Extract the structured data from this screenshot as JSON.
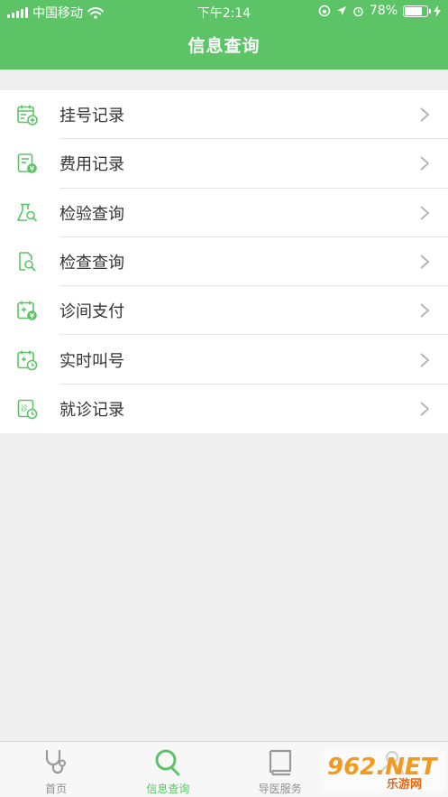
{
  "status": {
    "carrier": "中国移动",
    "time": "下午2:14",
    "battery": "78%",
    "battery_level": 0.78
  },
  "nav": {
    "title": "信息查询"
  },
  "menu": {
    "items": [
      {
        "label": "挂号记录",
        "icon": "calendar-plus-icon"
      },
      {
        "label": "费用记录",
        "icon": "bill-icon"
      },
      {
        "label": "检验查询",
        "icon": "flask-search-icon"
      },
      {
        "label": "检查查询",
        "icon": "document-search-icon"
      },
      {
        "label": "诊间支付",
        "icon": "calendar-pay-icon"
      },
      {
        "label": "实时叫号",
        "icon": "calendar-clock-icon"
      },
      {
        "label": "就诊记录",
        "icon": "record-clock-icon"
      }
    ]
  },
  "tabs": {
    "items": [
      {
        "label": "首页",
        "icon": "stethoscope-icon"
      },
      {
        "label": "信息查询",
        "icon": "search-icon"
      },
      {
        "label": "导医服务",
        "icon": "book-icon"
      },
      {
        "label": "",
        "icon": "user-icon"
      }
    ]
  },
  "watermark": {
    "brand": "962.NET",
    "caption": "乐游网"
  },
  "colors": {
    "accent": "#5cc466",
    "background": "#efefef",
    "text": "#333333",
    "tab_inactive": "#8f8f8f"
  }
}
